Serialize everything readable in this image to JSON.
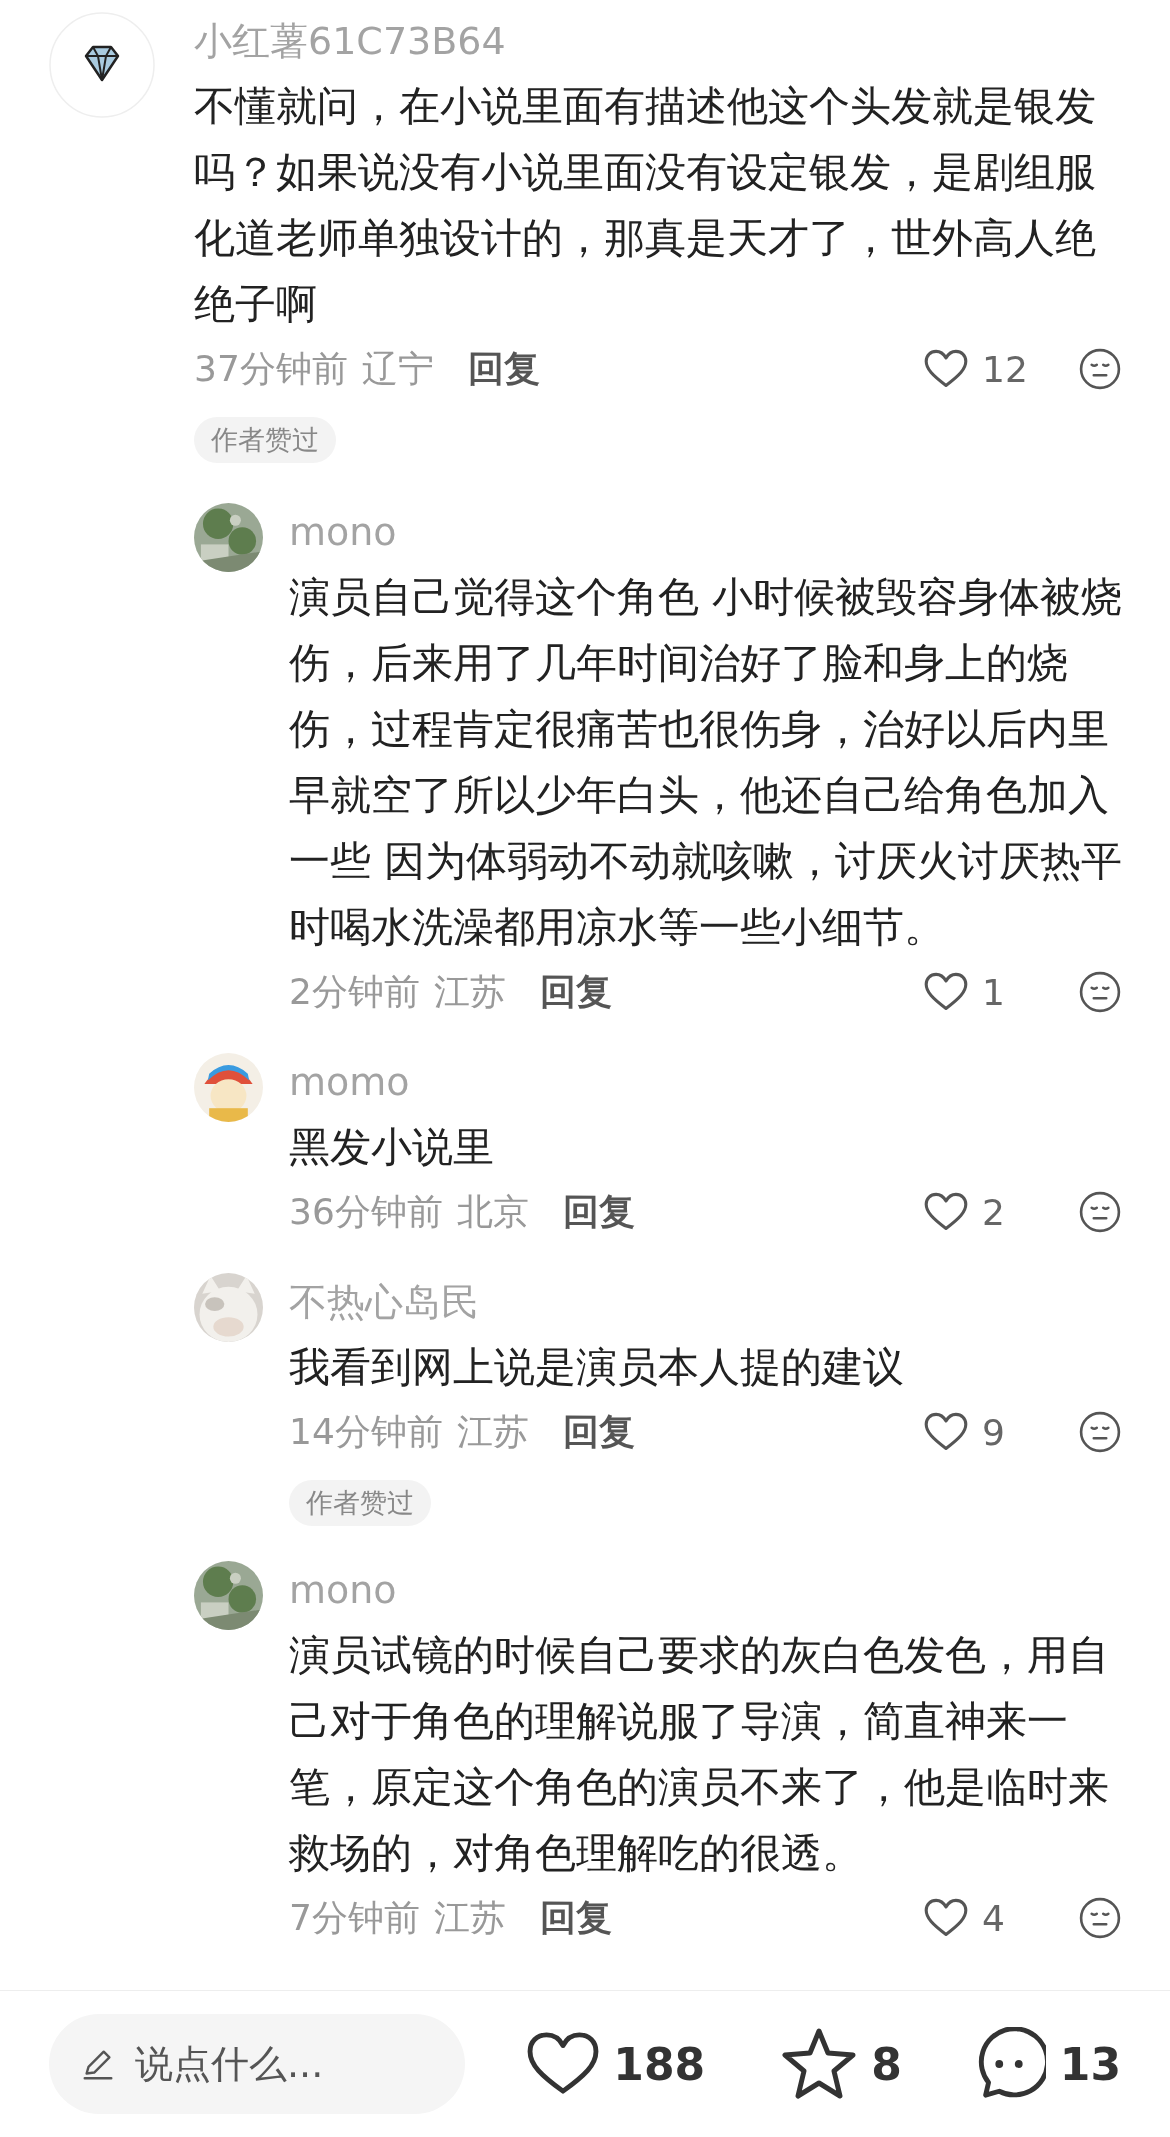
{
  "comments": [
    {
      "author": "小红薯61C73B64",
      "avatar": {
        "kind": "icon"
      },
      "text": "不懂就问，在小说里面有描述他这个头发就是银发吗？如果说没有小说里面没有设定银发，是剧组服化道老师单独设计的，那真是天才了，世外高人绝绝子啊",
      "time": "37分钟前",
      "location": "辽宁",
      "reply_label": "回复",
      "likes": "12",
      "badge": "作者赞过",
      "replies": [
        {
          "author": "mono",
          "text": "演员自己觉得这个角色 小时候被毁容身体被烧伤，后来用了几年时间治好了脸和身上的烧伤，过程肯定很痛苦也很伤身，治好以后内里早就空了所以少年白头，他还自己给角色加入一些 因为体弱动不动就咳嗽，讨厌火讨厌热平时喝水洗澡都用凉水等一些小细节。",
          "time": "2分钟前",
          "location": "江苏",
          "reply_label": "回复",
          "likes": "1"
        },
        {
          "author": "momo",
          "text": "黑发小说里",
          "time": "36分钟前",
          "location": "北京",
          "reply_label": "回复",
          "likes": "2"
        },
        {
          "author": "不热心岛民",
          "text": "我看到网上说是演员本人提的建议",
          "time": "14分钟前",
          "location": "江苏",
          "reply_label": "回复",
          "likes": "9",
          "badge": "作者赞过"
        },
        {
          "author": "mono",
          "text": "演员试镜的时候自己要求的灰白色发色，用自己对于角色的理解说服了导演，简直神来一笔，原定这个角色的演员不来了，他是临时来救场的，对角色理解吃的很透。",
          "time": "7分钟前",
          "location": "江苏",
          "reply_label": "回复",
          "likes": "4"
        }
      ]
    }
  ],
  "bottom_bar": {
    "placeholder": "说点什么...",
    "likes": "188",
    "favorites": "8",
    "comments": "13"
  }
}
